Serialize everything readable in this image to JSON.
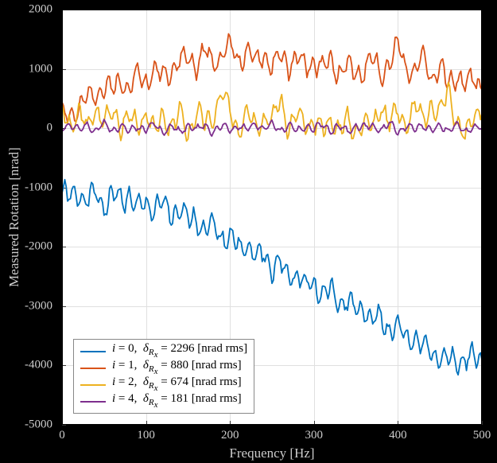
{
  "chart_data": {
    "type": "line",
    "title": "",
    "xlabel": "Frequency [Hz]",
    "ylabel": "Measured Rotation [nrad]",
    "xlim": [
      0,
      500
    ],
    "ylim": [
      -5000,
      2000
    ],
    "xticks": [
      0,
      100,
      200,
      300,
      400,
      500
    ],
    "yticks": [
      -5000,
      -4000,
      -3000,
      -2000,
      -1000,
      0,
      1000,
      2000
    ],
    "grid": true,
    "legend_position": "lower left",
    "x": [
      0,
      10,
      20,
      30,
      40,
      50,
      60,
      70,
      80,
      90,
      100,
      110,
      120,
      130,
      140,
      150,
      160,
      170,
      180,
      190,
      200,
      210,
      220,
      230,
      240,
      250,
      260,
      270,
      280,
      290,
      300,
      310,
      320,
      330,
      340,
      350,
      360,
      370,
      380,
      390,
      400,
      410,
      420,
      430,
      440,
      450,
      460,
      470,
      480,
      490,
      500
    ],
    "series": [
      {
        "name": "i = 0,  δ_{R_x} = 2296 [nrad rms]",
        "color": "#0072BD",
        "values": [
          -1100,
          -1200,
          -1050,
          -1250,
          -1100,
          -1300,
          -1150,
          -1200,
          -1100,
          -1400,
          -1250,
          -1350,
          -1300,
          -1450,
          -1400,
          -1550,
          -1500,
          -1700,
          -1650,
          -1800,
          -1850,
          -2000,
          -1950,
          -2200,
          -2100,
          -2350,
          -2300,
          -2500,
          -2450,
          -2650,
          -2600,
          -2800,
          -2750,
          -2950,
          -2900,
          -3100,
          -3050,
          -3250,
          -3200,
          -3400,
          -3350,
          -3550,
          -3500,
          -3700,
          -3750,
          -3850,
          -3900,
          -3950,
          -3900,
          -3850,
          -3900
        ]
      },
      {
        "name": "i = 1,  δ_{R_x} = 880 [nrad rms]",
        "color": "#D95319",
        "values": [
          250,
          200,
          350,
          500,
          600,
          700,
          650,
          800,
          700,
          900,
          800,
          950,
          900,
          1000,
          1100,
          1200,
          1050,
          1300,
          1100,
          1250,
          1400,
          1150,
          1300,
          1100,
          1250,
          1050,
          1200,
          1050,
          1200,
          1000,
          1150,
          1000,
          1100,
          950,
          1050,
          900,
          1000,
          1200,
          900,
          1100,
          1400,
          1000,
          950,
          1250,
          850,
          1000,
          750,
          900,
          700,
          850,
          650
        ]
      },
      {
        "name": "i = 2,  δ_{R_x} = 674 [nrad rms]",
        "color": "#EDB120",
        "values": [
          300,
          50,
          250,
          0,
          350,
          100,
          300,
          50,
          200,
          0,
          250,
          -50,
          200,
          0,
          250,
          -100,
          300,
          50,
          200,
          600,
          250,
          0,
          300,
          50,
          200,
          100,
          500,
          0,
          200,
          50,
          100,
          -50,
          150,
          0,
          100,
          -50,
          150,
          0,
          400,
          100,
          300,
          50,
          350,
          150,
          400,
          200,
          700,
          100,
          -200,
          300,
          250
        ]
      },
      {
        "name": "i = 4,  δ_{R_x} = 181 [nrad rms]",
        "color": "#7E2F8E",
        "values": [
          0,
          80,
          -50,
          60,
          -40,
          70,
          -30,
          50,
          -60,
          40,
          -20,
          60,
          -50,
          30,
          -70,
          50,
          -30,
          40,
          -60,
          30,
          -20,
          50,
          -40,
          70,
          0,
          60,
          -30,
          50,
          -50,
          40,
          -20,
          60,
          -40,
          30,
          -60,
          50,
          0,
          40,
          -30,
          70,
          -50,
          30,
          -20,
          60,
          -40,
          20,
          -30,
          50,
          -60,
          30,
          0
        ]
      }
    ]
  }
}
